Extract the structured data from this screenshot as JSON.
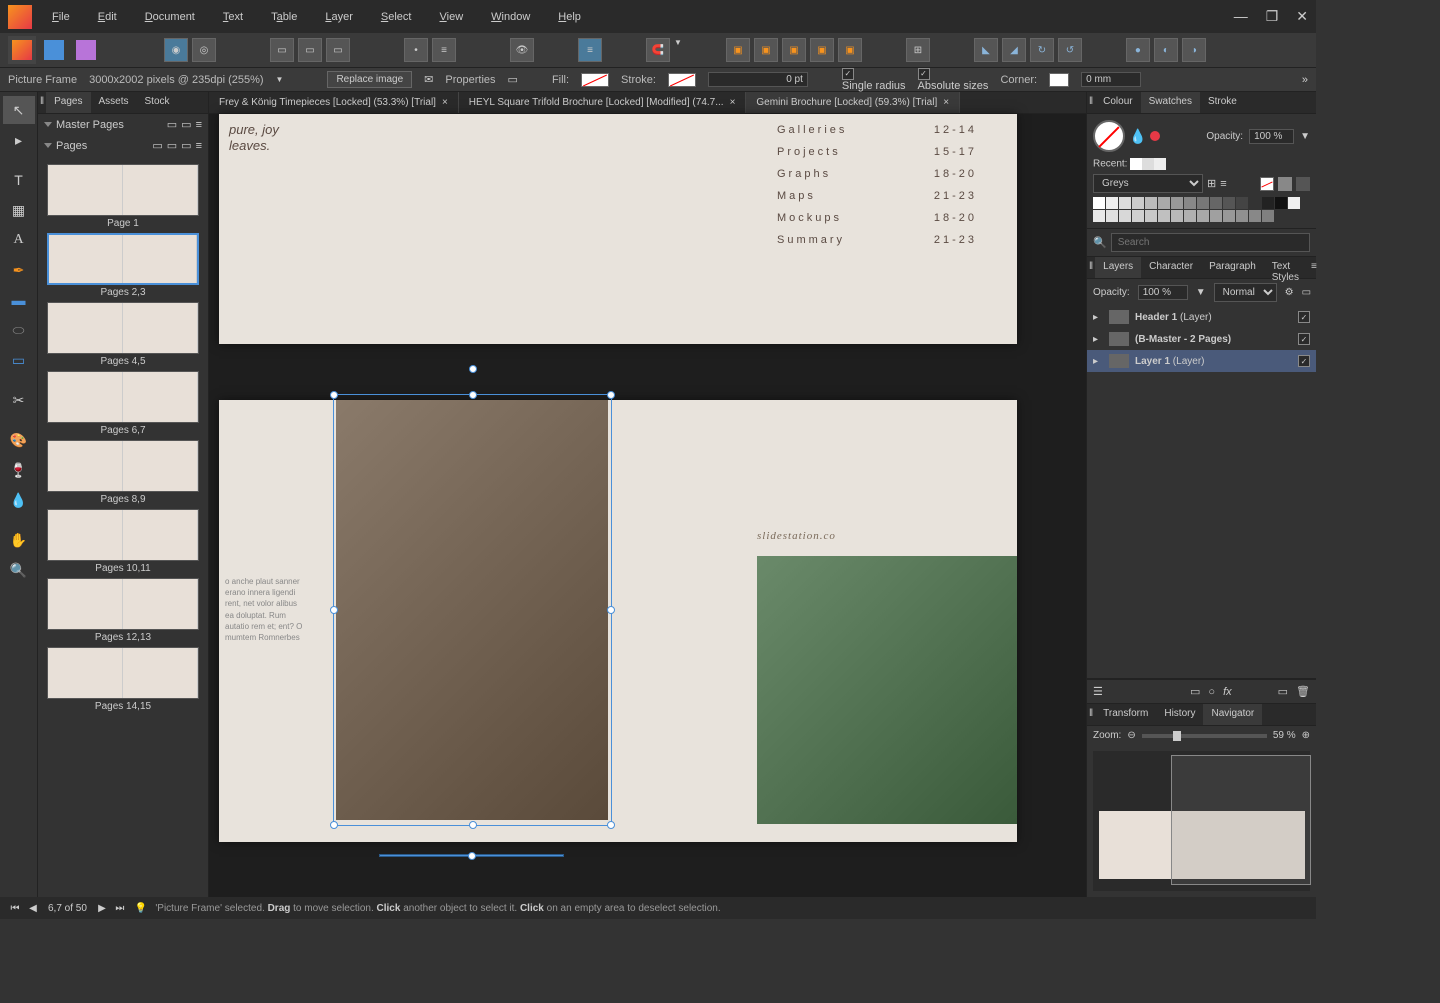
{
  "menu": {
    "file": "File",
    "edit": "Edit",
    "document": "Document",
    "text": "Text",
    "table": "Table",
    "layer": "Layer",
    "select": "Select",
    "view": "View",
    "window": "Window",
    "help": "Help"
  },
  "context": {
    "tool_name": "Picture Frame",
    "dimensions": "3000x2002 pixels @ 235dpi (255%)",
    "replace": "Replace image",
    "properties": "Properties",
    "fill": "Fill:",
    "stroke": "Stroke:",
    "stroke_val": "0 pt",
    "single_radius": "Single radius",
    "absolute_sizes": "Absolute sizes",
    "corner": "Corner:",
    "corner_val": "0 mm"
  },
  "doc_tabs": [
    {
      "label": "Frey & König Timepieces [Locked] (53.3%) [Trial]",
      "active": false
    },
    {
      "label": "HEYL Square Trifold Brochure [Locked] [Modified] (74.7...",
      "active": false
    },
    {
      "label": "Gemini Brochure [Locked] (59.3%) [Trial]",
      "active": true
    }
  ],
  "pages_panel": {
    "tabs": [
      "Pages",
      "Assets",
      "Stock"
    ],
    "master": "Master Pages",
    "pages": "Pages",
    "thumbs": [
      {
        "label": "Page 1",
        "selected": false
      },
      {
        "label": "Pages 2,3",
        "selected": true
      },
      {
        "label": "Pages 4,5",
        "selected": false
      },
      {
        "label": "Pages 6,7",
        "selected": false
      },
      {
        "label": "Pages 8,9",
        "selected": false
      },
      {
        "label": "Pages 10,11",
        "selected": false
      },
      {
        "label": "Pages 12,13",
        "selected": false
      },
      {
        "label": "Pages 14,15",
        "selected": false
      }
    ]
  },
  "canvas": {
    "italic1": "pure, joy",
    "italic2": "leaves.",
    "toc": [
      {
        "k": "Galleries",
        "v": "12-14"
      },
      {
        "k": "Projects",
        "v": "15-17"
      },
      {
        "k": "Graphs",
        "v": "18-20"
      },
      {
        "k": "Maps",
        "v": "21-23"
      },
      {
        "k": "Mockups",
        "v": "18-20"
      },
      {
        "k": "Summary",
        "v": "21-23"
      }
    ],
    "url": "slidestation.co",
    "body": "o anche plaut sanner erano innera ligendi rent, net volor alibus ea doluptat. Rum autatio rem et; ent? O mumtem Romnerbes"
  },
  "swatches": {
    "tabs": [
      "Colour",
      "Swatches",
      "Stroke"
    ],
    "opacity_label": "Opacity:",
    "opacity_val": "100 %",
    "recent": "Recent:",
    "palette": "Greys",
    "search_placeholder": "Search"
  },
  "layers": {
    "tabs": [
      "Layers",
      "Character",
      "Paragraph",
      "Text Styles"
    ],
    "opacity_label": "Opacity:",
    "opacity_val": "100 %",
    "blend": "Normal",
    "items": [
      {
        "name": "Header 1",
        "suffix": "(Layer)",
        "selected": false
      },
      {
        "name": "(B-Master - 2 Pages)",
        "suffix": "",
        "selected": false
      },
      {
        "name": "Layer 1",
        "suffix": "(Layer)",
        "selected": true
      }
    ]
  },
  "navigator": {
    "tabs": [
      "Transform",
      "History",
      "Navigator"
    ],
    "zoom_label": "Zoom:",
    "zoom_val": "59 %"
  },
  "status": {
    "page": "6,7 of 50",
    "hint_prefix": "'Picture Frame' selected. ",
    "drag": "Drag",
    "hint_mid": " to move selection. ",
    "click": "Click",
    "hint_mid2": " another object to select it. ",
    "click2": "Click",
    "hint_end": " on an empty area to deselect selection."
  }
}
